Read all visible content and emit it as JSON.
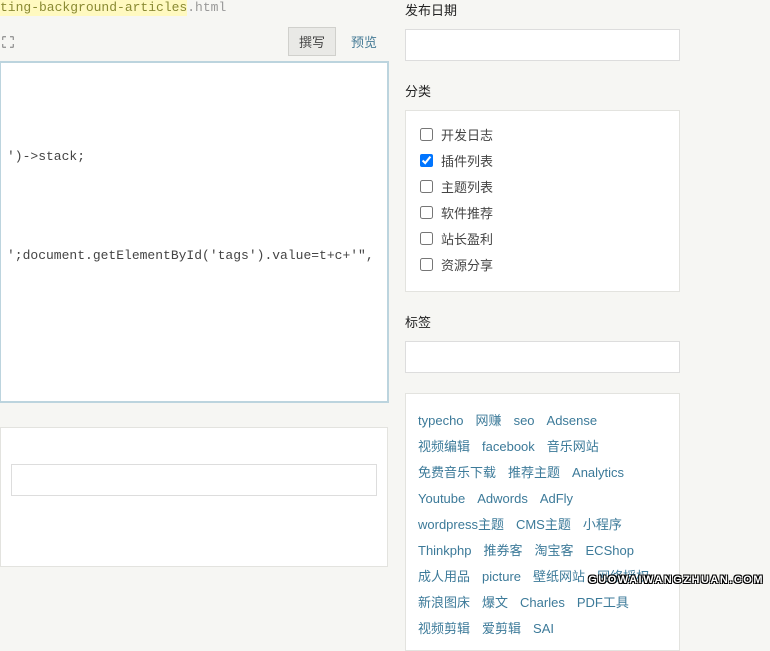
{
  "slug": {
    "highlight": "ting-background-articles",
    "ext": ".html"
  },
  "toolbar": {
    "write": "撰写",
    "preview": "预览"
  },
  "editor": {
    "value": "\n\n\n')->stack;\n\n\n\n';document.getElementById('tags').value=t+c+'\","
  },
  "extra": {
    "placeholder": ""
  },
  "date": {
    "title": "发布日期",
    "value": ""
  },
  "category": {
    "title": "分类",
    "items": [
      {
        "label": "开发日志",
        "checked": false
      },
      {
        "label": "插件列表",
        "checked": true
      },
      {
        "label": "主题列表",
        "checked": false
      },
      {
        "label": "软件推荐",
        "checked": false
      },
      {
        "label": "站长盈利",
        "checked": false
      },
      {
        "label": "资源分享",
        "checked": false
      }
    ]
  },
  "tags": {
    "title": "标签",
    "value": ""
  },
  "tagCloud": [
    "typecho",
    "网赚",
    "seo",
    "Adsense",
    "视频编辑",
    "facebook",
    "音乐网站",
    "免费音乐下载",
    "推荐主题",
    "Analytics",
    "Youtube",
    "Adwords",
    "AdFly",
    "wordpress主题",
    "CMS主题",
    "小程序",
    "Thinkphp",
    "推券客",
    "淘宝客",
    "ECShop",
    "成人用品",
    "picture",
    "壁纸网站",
    "网络授权",
    "新浪图床",
    "爆文",
    "Charles",
    "PDF工具",
    "视频剪辑",
    "爱剪辑",
    "SAI"
  ],
  "watermark": "GUOWAIWANGZHUAN.COM"
}
